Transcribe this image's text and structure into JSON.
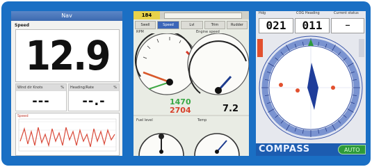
{
  "screen_speed": {
    "title": "Nav",
    "speed_label": "Speed",
    "speed_value": "12.9",
    "box_left_label": "Wind dir Knots",
    "box_left_unit": "%",
    "box_left_value": "---",
    "box_right_label": "Heading/Rate",
    "box_right_unit": "%",
    "box_right_value": "--.-",
    "graph_label": "Speed"
  },
  "screen_gauges": {
    "top_value": "184",
    "tabs": [
      "Swell",
      "Speed",
      "Lvl",
      "Trim",
      "Rudder"
    ],
    "active_tab": 1,
    "rpm_label": "RPM",
    "speed_label": "Engine speed",
    "left_gauge_value_top": "1470",
    "left_gauge_value_bottom": "2704",
    "right_gauge_value": "7.2",
    "small_left_label": "Fuel level",
    "small_right_label": "Temp"
  },
  "screen_compass": {
    "head_left": "Hdg",
    "head_mid": "COG Heading",
    "head_right": "Current status",
    "num_left": "021",
    "num_mid": "011",
    "num_right": "—",
    "compass_label": "COMPASS",
    "auto_label": "AUTO",
    "accent_blue": "#1c5cb0",
    "accent_green": "#2e9a3a"
  }
}
